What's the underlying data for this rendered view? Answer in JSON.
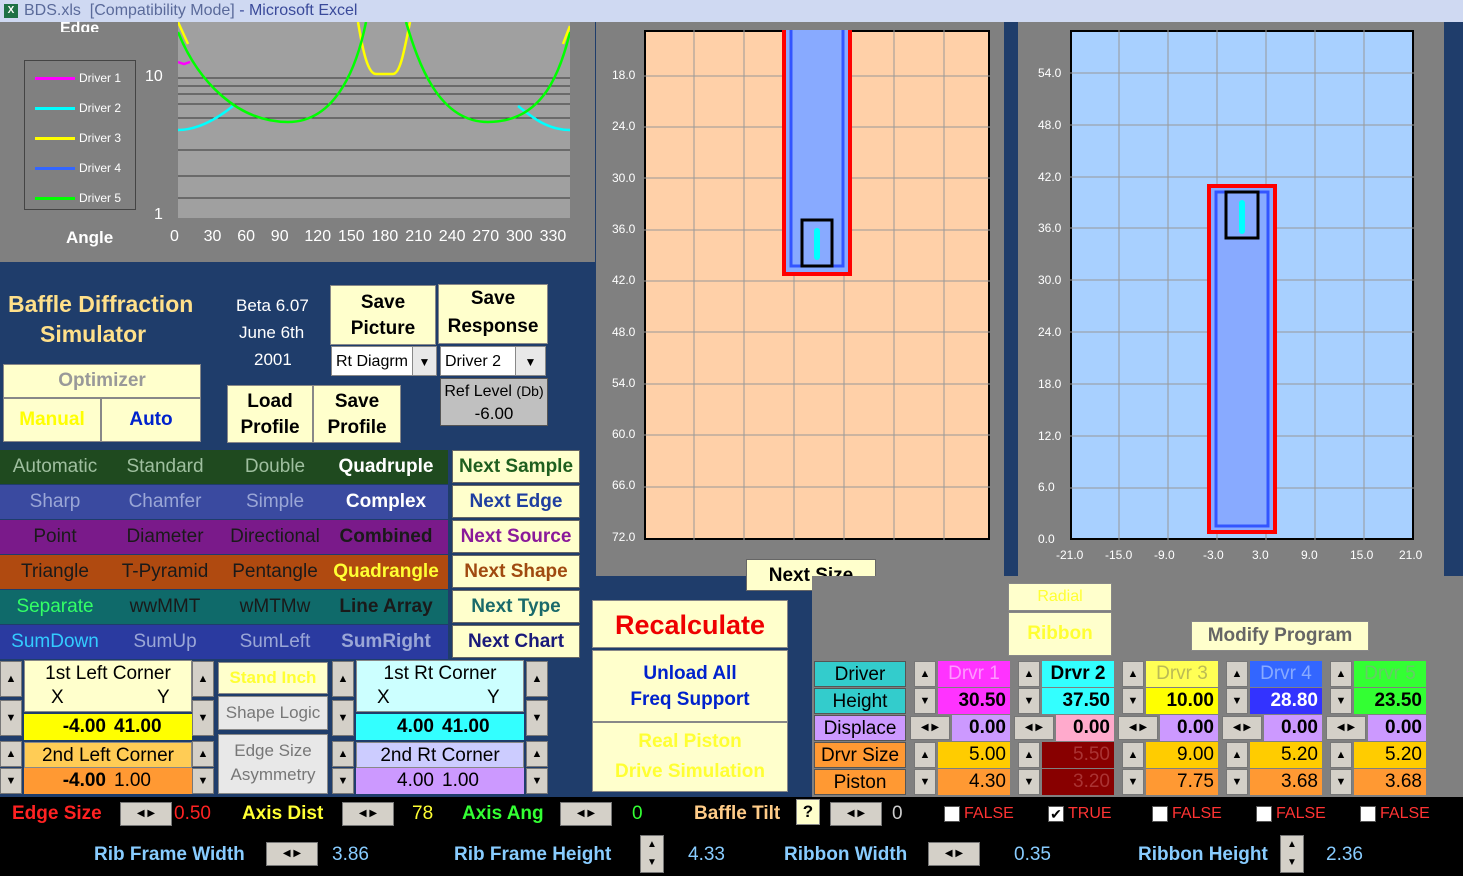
{
  "window": {
    "title_file": "BDS.xls",
    "title_mode": "[Compatibility Mode]",
    "title_app": "- Microsoft Excel"
  },
  "polar_chart": {
    "edge_label": "Edge",
    "angle_label": "Angle",
    "y_ticks": [
      "10",
      "1"
    ],
    "x_ticks": [
      "0",
      "30",
      "60",
      "90",
      "120",
      "150",
      "180",
      "210",
      "240",
      "270",
      "300",
      "330"
    ],
    "legend": [
      {
        "name": "Driver 1",
        "color": "#ff00ff"
      },
      {
        "name": "Driver 2",
        "color": "#00ffff"
      },
      {
        "name": "Driver 3",
        "color": "#ffff00"
      },
      {
        "name": "Driver 4",
        "color": "#3366ff"
      },
      {
        "name": "Driver 5",
        "color": "#00ff00"
      }
    ]
  },
  "app": {
    "title_line1": "Baffle Diffraction",
    "title_line2": "Simulator",
    "version": "Beta 6.07",
    "date": "June 6th",
    "year": "2001"
  },
  "buttons": {
    "save_picture_1": "Save",
    "save_picture_2": "Picture",
    "save_response_1": "Save",
    "save_response_2": "Response",
    "load_profile_1": "Load",
    "load_profile_2": "Profile",
    "save_profile_1": "Save",
    "save_profile_2": "Profile",
    "optimizer": "Optimizer",
    "manual": "Manual",
    "auto": "Auto",
    "next_size": "Next Size",
    "recalculate": "Recalculate",
    "unload_1": "Unload All",
    "unload_2": "Freq Support",
    "real_piston_1": "Real Piston",
    "real_piston_2": "Drive Simulation",
    "radial": "Radial",
    "ribbon": "Ribbon",
    "modify_program": "Modify Program",
    "stand_inch": "Stand Inch",
    "shape_logic": "Shape Logic",
    "edge_size_asym_1": "Edge Size",
    "edge_size_asym_2": "Asymmetry"
  },
  "selects": {
    "diagram": "Rt Diagrm",
    "driver": "Driver 2"
  },
  "ref_level": {
    "label": "Ref Level",
    "unit": "(Db)",
    "value": "-6.00"
  },
  "option_rows": [
    {
      "bg": "#1f4a1f",
      "items": [
        "Automatic",
        "Standard",
        "Double",
        "Quadruple"
      ],
      "colors": [
        "#9fbf9f",
        "#9fbf9f",
        "#9fbf9f",
        "#ffffff"
      ],
      "next": "Next Sample",
      "next_color": "#1f5f1f"
    },
    {
      "bg": "#3a4aa0",
      "items": [
        "Sharp",
        "Chamfer",
        "Simple",
        "Complex"
      ],
      "colors": [
        "#9aa6d6",
        "#9aa6d6",
        "#9aa6d6",
        "#ffffff"
      ],
      "next": "Next Edge",
      "next_color": "#1f3fa0"
    },
    {
      "bg": "#7a1a8a",
      "items": [
        "Point",
        "Diameter",
        "Directional",
        "Combined"
      ],
      "colors": [
        "#1a1a1a",
        "#1a1a1a",
        "#1a1a1a",
        "#1a1a1a"
      ],
      "next": "Next Source",
      "next_color": "#8a1a9a"
    },
    {
      "bg": "#b04a10",
      "items": [
        "Triangle",
        "T-Pyramid",
        "Pentangle",
        "Quadrangle"
      ],
      "colors": [
        "#1a1a1a",
        "#1a1a1a",
        "#1a1a1a",
        "#ffff33"
      ],
      "next": "Next Shape",
      "next_color": "#a04a10"
    },
    {
      "bg": "#0f6a6a",
      "items": [
        "Separate",
        "wwMMT",
        "wMTMw",
        "Line Array"
      ],
      "colors": [
        "#33ff66",
        "#1a1a1a",
        "#1a1a1a",
        "#1a1a1a"
      ],
      "next": "Next Type",
      "next_color": "#1a6a6a"
    },
    {
      "bg": "#2a3aa0",
      "items": [
        "SumDown",
        "SumUp",
        "SumLeft",
        "SumRight"
      ],
      "colors": [
        "#33ccff",
        "#9aa6d6",
        "#9aa6d6",
        "#9aa6d6"
      ],
      "next": "Next Chart",
      "next_color": "#1a1a7a"
    }
  ],
  "corners": {
    "left1": {
      "title": "1st Left Corner",
      "x_label": "X",
      "y_label": "Y",
      "x": "-4.00",
      "y": "41.00"
    },
    "left2": {
      "title": "2nd Left Corner",
      "x": "-4.00",
      "y": "1.00"
    },
    "rt1": {
      "title": "1st Rt Corner",
      "x_label": "X",
      "y_label": "Y",
      "x": "4.00",
      "y": "41.00"
    },
    "rt2": {
      "title": "2nd Rt Corner",
      "x": "4.00",
      "y": "1.00"
    }
  },
  "side_chart": {
    "y_ticks": [
      "18.0",
      "24.0",
      "30.0",
      "36.0",
      "42.0",
      "48.0",
      "54.0",
      "60.0",
      "66.0",
      "72.0"
    ]
  },
  "front_chart": {
    "y_ticks": [
      "54.0",
      "48.0",
      "42.0",
      "36.0",
      "30.0",
      "24.0",
      "18.0",
      "12.0",
      "6.0",
      "0.0"
    ],
    "x_ticks": [
      "-21.0",
      "-15.0",
      "-9.0",
      "-3.0",
      "3.0",
      "9.0",
      "15.0",
      "21.0"
    ]
  },
  "driver_table": {
    "row_labels": [
      "Driver",
      "Height",
      "Displace",
      "Drvr Size",
      "Piston"
    ],
    "drivers": [
      {
        "name": "Drvr 1",
        "height": "30.50",
        "displace": "0.00",
        "size": "5.00",
        "piston": "4.30"
      },
      {
        "name": "Drvr 2",
        "height": "37.50",
        "displace": "0.00",
        "size": "5.50",
        "piston": "3.20"
      },
      {
        "name": "Drvr 3",
        "height": "10.00",
        "displace": "0.00",
        "size": "9.00",
        "piston": "7.75"
      },
      {
        "name": "Drvr 4",
        "height": "28.80",
        "displace": "0.00",
        "size": "5.20",
        "piston": "3.68"
      },
      {
        "name": "Drvr 5",
        "height": "23.50",
        "displace": "0.00",
        "size": "5.20",
        "piston": "3.68"
      }
    ]
  },
  "bottom1": {
    "edge_size_label": "Edge Size",
    "edge_size": "0.50",
    "axis_dist_label": "Axis Dist",
    "axis_dist": "78",
    "axis_ang_label": "Axis Ang",
    "axis_ang": "0",
    "baffle_tilt_label": "Baffle Tilt",
    "help": "?",
    "baffle_tilt": "0",
    "flags": [
      "FALSE",
      "TRUE",
      "FALSE",
      "FALSE",
      "FALSE"
    ]
  },
  "bottom2": {
    "rib_w_label": "Rib Frame Width",
    "rib_w": "3.86",
    "rib_h_label": "Rib Frame Height",
    "rib_h": "4.33",
    "ribbon_w_label": "Ribbon Width",
    "ribbon_w": "0.35",
    "ribbon_h_label": "Ribbon Height",
    "ribbon_h": "2.36"
  }
}
